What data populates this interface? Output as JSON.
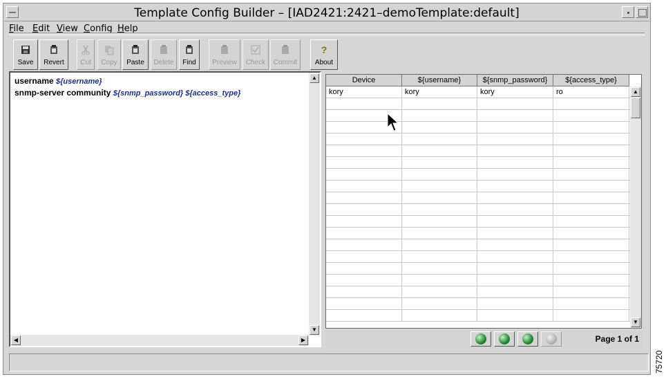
{
  "window": {
    "title": "Template Config Builder – [IAD2421:2421–demoTemplate:default]"
  },
  "menu": [
    "File",
    "Edit",
    "View",
    "Config",
    "Help"
  ],
  "toolbar": [
    {
      "label": "Save",
      "icon": "save-icon",
      "enabled": true
    },
    {
      "label": "Revert",
      "icon": "revert-icon",
      "enabled": true
    },
    {
      "label": "Cut",
      "icon": "cut-icon",
      "enabled": false
    },
    {
      "label": "Copy",
      "icon": "copy-icon",
      "enabled": false
    },
    {
      "label": "Paste",
      "icon": "paste-icon",
      "enabled": true
    },
    {
      "label": "Delete",
      "icon": "delete-icon",
      "enabled": false
    },
    {
      "label": "Find",
      "icon": "find-icon",
      "enabled": true
    },
    {
      "label": "Preview",
      "icon": "preview-icon",
      "enabled": false
    },
    {
      "label": "Check",
      "icon": "check-icon",
      "enabled": false
    },
    {
      "label": "Commit",
      "icon": "commit-icon",
      "enabled": false
    },
    {
      "label": "About",
      "icon": "about-icon",
      "enabled": true
    }
  ],
  "editor": {
    "line1": {
      "text": "username ",
      "var": "${username}"
    },
    "line2": {
      "text": "snmp-server community ",
      "var": "${snmp_password} ${access_type}"
    }
  },
  "table": {
    "headers": [
      "Device",
      "${username}",
      "${snmp_password}",
      "${access_type}"
    ],
    "rows": [
      [
        "kory",
        "kory",
        "kory",
        "ro"
      ]
    ]
  },
  "pager": {
    "text": "Page 1 of 1"
  },
  "figure_number": "75720"
}
